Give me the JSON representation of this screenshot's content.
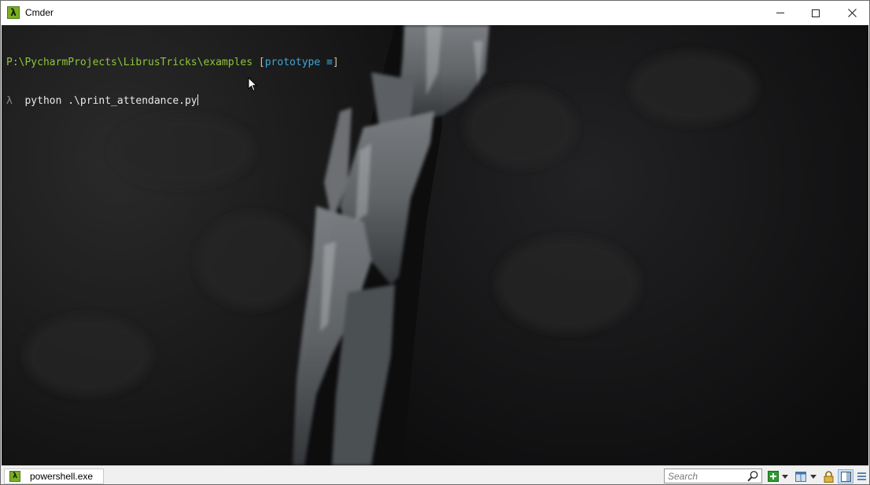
{
  "window": {
    "title": "Cmder"
  },
  "icons": {
    "app": "lambda-icon",
    "minimize": "minimize-icon",
    "maximize": "maximize-icon",
    "close": "close-icon",
    "tab": "lambda-icon",
    "search": "magnifier-icon",
    "new_console": "plus-icon",
    "layout": "split-panel-icon",
    "lock": "lock-icon",
    "view": "pane-view-icon",
    "menu": "hamburger-menu-icon"
  },
  "terminal": {
    "prompt_path": "P:\\PycharmProjects\\LibrusTricks\\examples",
    "bracket_open": "[",
    "branch": "prototype",
    "branch_status": "≡",
    "bracket_close": "]",
    "lambda": "λ",
    "command": "python .\\print_attendance.py"
  },
  "statusbar": {
    "tab_label": "powershell.exe",
    "search_placeholder": "Search"
  },
  "colors": {
    "path": "#8ec63a",
    "branch": "#3fa7d6",
    "terminal_bg": "#0b0b0b",
    "app_icon": "#7cae24"
  }
}
